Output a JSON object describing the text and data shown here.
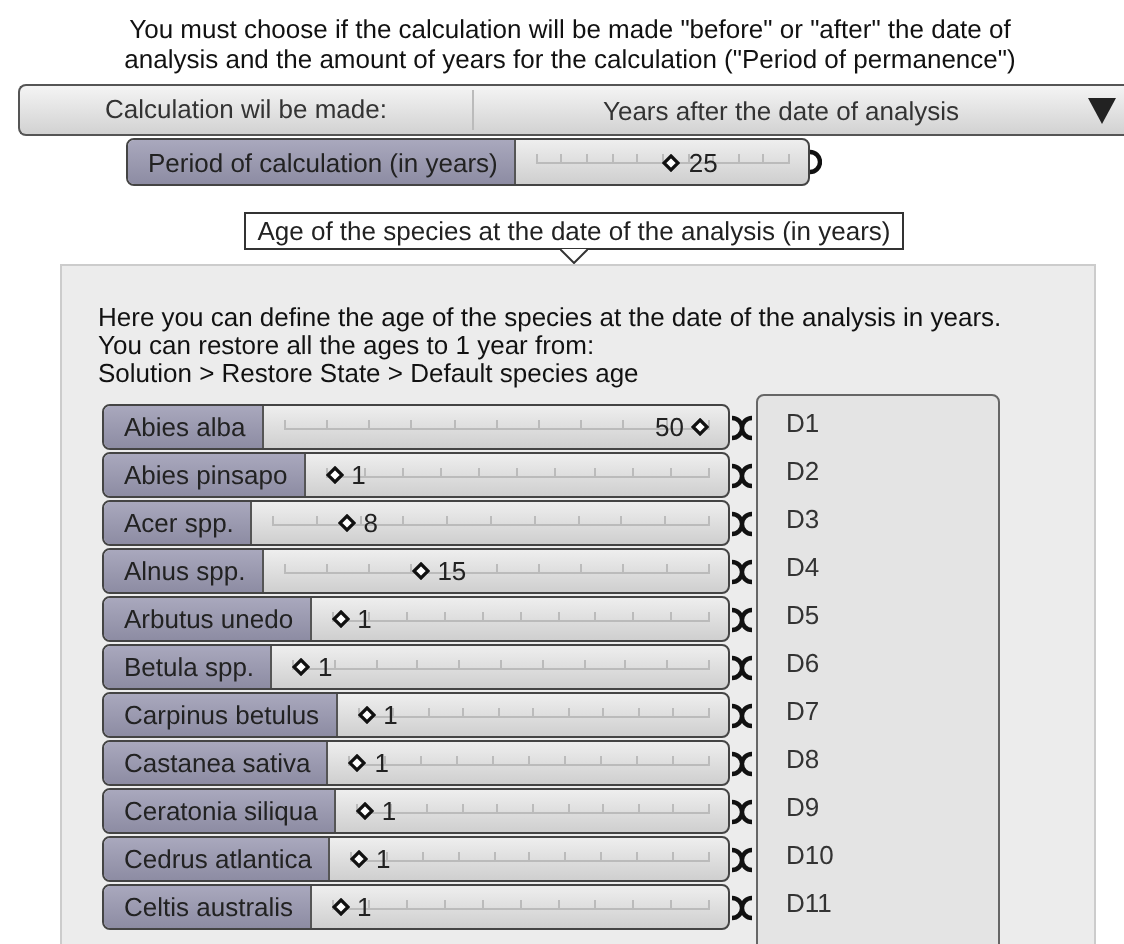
{
  "instructions": "You must choose if the calculation will be made \"before\" or \"after\" the date of analysis and the amount of years for the calculation (\"Period of permanence\")",
  "calculation_mode": {
    "label": "Calculation wil be made:",
    "value": "Years after the date of analysis"
  },
  "period_slider": {
    "label": "Period of calculation (in years)",
    "reading": "25",
    "level": 0.5
  },
  "group_label": "Age of the species at the date of the analysis (in years)",
  "panel_text": [
    "Here you can define the age of the species at the date of the analysis in years.",
    "You can restore all the ages to 1 year from:",
    "Solution > Restore State > Default species age"
  ],
  "species_sliders": [
    {
      "label": "Abies alba",
      "reading": "50",
      "level": 1.0
    },
    {
      "label": "Abies pinsapo",
      "reading": "1",
      "level": 0.0
    },
    {
      "label": "Acer spp.",
      "reading": "8",
      "level": 0.15
    },
    {
      "label": "Alnus spp.",
      "reading": "15",
      "level": 0.3
    },
    {
      "label": "Arbutus unedo",
      "reading": "1",
      "level": 0.0
    },
    {
      "label": "Betula spp.",
      "reading": "1",
      "level": 0.0
    },
    {
      "label": "Carpinus betulus",
      "reading": "1",
      "level": 0.0
    },
    {
      "label": "Castanea sativa",
      "reading": "1",
      "level": 0.0
    },
    {
      "label": "Ceratonia siliqua",
      "reading": "1",
      "level": 0.0
    },
    {
      "label": "Cedrus atlantica",
      "reading": "1",
      "level": 0.0
    },
    {
      "label": "Celtis australis",
      "reading": "1",
      "level": 0.0
    }
  ],
  "outputs": [
    "D1",
    "D2",
    "D3",
    "D4",
    "D5",
    "D6",
    "D7",
    "D8",
    "D9",
    "D10",
    "D11"
  ]
}
